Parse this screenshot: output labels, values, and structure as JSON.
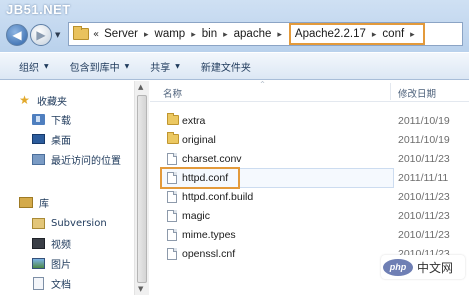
{
  "watermark": "JB51.NET",
  "address": {
    "lead_chevrons": "«",
    "crumbs": [
      "Server",
      "wamp",
      "bin",
      "apache"
    ],
    "highlighted_crumbs": [
      "Apache2.2.17",
      "conf"
    ],
    "separator": "▸"
  },
  "toolbar": {
    "items": [
      {
        "label": "组织",
        "has_menu": true
      },
      {
        "label": "包含到库中",
        "has_menu": true
      },
      {
        "label": "共享",
        "has_menu": true
      },
      {
        "label": "新建文件夹",
        "has_menu": false
      }
    ],
    "menu_arrow": "▼"
  },
  "nav": {
    "favorites_label": "收藏夹",
    "favorites": [
      "下载",
      "桌面",
      "最近访问的位置"
    ],
    "libraries_label": "库",
    "libraries": [
      "Subversion",
      "视频",
      "图片",
      "文档"
    ]
  },
  "columns": {
    "name": "名称",
    "date": "修改日期"
  },
  "files": [
    {
      "name": "extra",
      "type": "folder",
      "date": "2011/10/19"
    },
    {
      "name": "original",
      "type": "folder",
      "date": "2011/10/19"
    },
    {
      "name": "charset.conv",
      "type": "file",
      "date": "2010/11/23"
    },
    {
      "name": "httpd.conf",
      "type": "file",
      "date": "2011/11/11",
      "highlighted": true
    },
    {
      "name": "httpd.conf.build",
      "type": "file",
      "date": "2010/11/23"
    },
    {
      "name": "magic",
      "type": "file",
      "date": "2010/11/23"
    },
    {
      "name": "mime.types",
      "type": "file",
      "date": "2010/11/23"
    },
    {
      "name": "openssl.cnf",
      "type": "file",
      "date": "2010/11/23"
    }
  ],
  "badge": {
    "logo": "php",
    "text": "中文网"
  },
  "colors": {
    "highlight_box": "#e39a3b",
    "toolbar_text": "#1e395b"
  }
}
